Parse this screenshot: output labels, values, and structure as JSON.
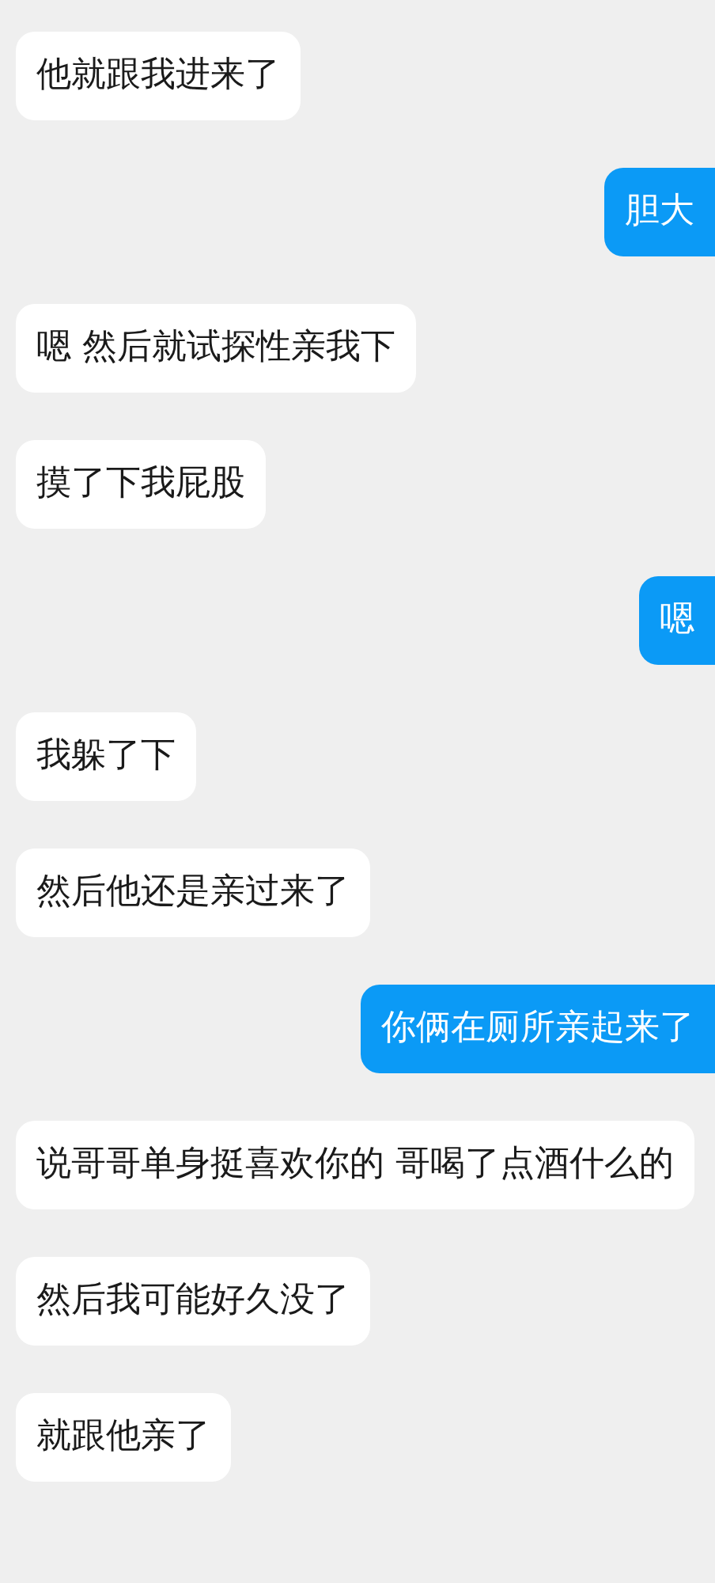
{
  "messages": [
    {
      "kind": "received",
      "text": "他就跟我进来了"
    },
    {
      "kind": "sent",
      "text": "胆大"
    },
    {
      "kind": "received",
      "text": "嗯 然后就试探性亲我下"
    },
    {
      "kind": "received",
      "text": "摸了下我屁股"
    },
    {
      "kind": "sent",
      "text": "嗯"
    },
    {
      "kind": "received",
      "text": "我躲了下"
    },
    {
      "kind": "received",
      "text": "然后他还是亲过来了"
    },
    {
      "kind": "sent",
      "text": "你俩在厕所亲起来了"
    },
    {
      "kind": "received",
      "text": "说哥哥单身挺喜欢你的 哥喝了点酒什么的"
    },
    {
      "kind": "received",
      "text": "然后我可能好久没了"
    },
    {
      "kind": "received",
      "text": "就跟他亲了"
    }
  ]
}
